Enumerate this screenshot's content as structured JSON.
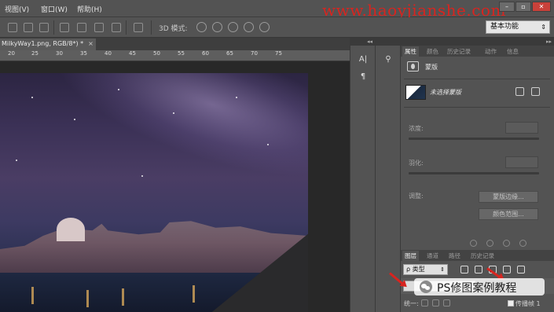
{
  "menubar": {
    "items": [
      "视图(V)",
      "窗口(W)",
      "帮助(H)"
    ],
    "watermark": "www.haoyjianshe.com",
    "window_buttons": [
      "–",
      "▫",
      "✕"
    ]
  },
  "options_bar": {
    "mode_label": "3D 模式:",
    "workspace": "基本功能"
  },
  "document": {
    "tab_label": "MilkyWay1.png, RGB/8*) *",
    "tab_close": "×"
  },
  "ruler": {
    "ticks": [
      "20",
      "25",
      "30",
      "35",
      "40",
      "45",
      "50",
      "55",
      "60",
      "65",
      "70",
      "75"
    ]
  },
  "collapse_panel": {
    "toggle": "◂◂",
    "icons": [
      "A|",
      "¶"
    ]
  },
  "properties": {
    "tabs": [
      "属性",
      "颜色",
      "历史记录",
      "动作",
      "信息"
    ],
    "title": "蒙版",
    "layer_name": "未选择蒙版",
    "density_label": "浓度:",
    "feather_label": "羽化:",
    "adjust_label": "调整:",
    "mask_edge_button": "蒙版边缘...",
    "color_range_button": "颜色范围..."
  },
  "layers": {
    "tabs": [
      "图层",
      "通道",
      "路径",
      "历史记录"
    ],
    "filter_value": "ρ 类型",
    "lock_label": "统一:",
    "propagate_label": "传播帧 1"
  },
  "watermark_badge": {
    "text": "PS修图案例教程"
  }
}
